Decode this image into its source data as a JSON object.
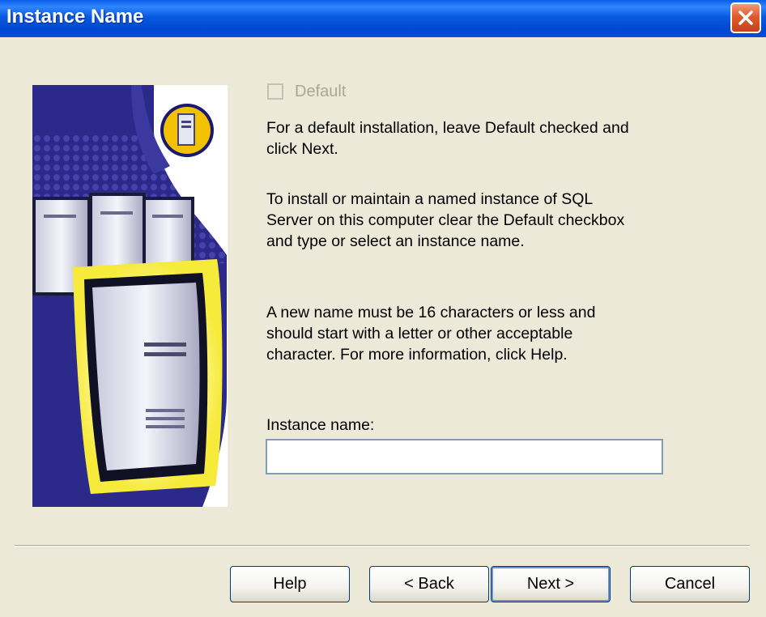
{
  "window": {
    "title": "Instance Name",
    "close_icon": "close-icon"
  },
  "checkbox": {
    "label": "Default",
    "checked": false,
    "enabled": false
  },
  "paragraphs": {
    "p1": "For a default installation, leave Default checked and\nclick Next.",
    "p2": "To install or maintain a named instance of SQL\nServer on this computer clear the Default checkbox\nand type or select an instance name.",
    "p3": "A new name must be 16 characters or less and\nshould start with a letter or other acceptable\ncharacter.  For more information, click Help."
  },
  "instance": {
    "label": "Instance name:",
    "value": ""
  },
  "buttons": {
    "help": "Help",
    "back": "< Back",
    "next": "Next >",
    "cancel": "Cancel"
  },
  "colors": {
    "titlebar": "#0a5ae0",
    "dialog_bg": "#ece9d8",
    "graphic_navy": "#2b2a8a",
    "badge_yellow": "#f2c200"
  }
}
